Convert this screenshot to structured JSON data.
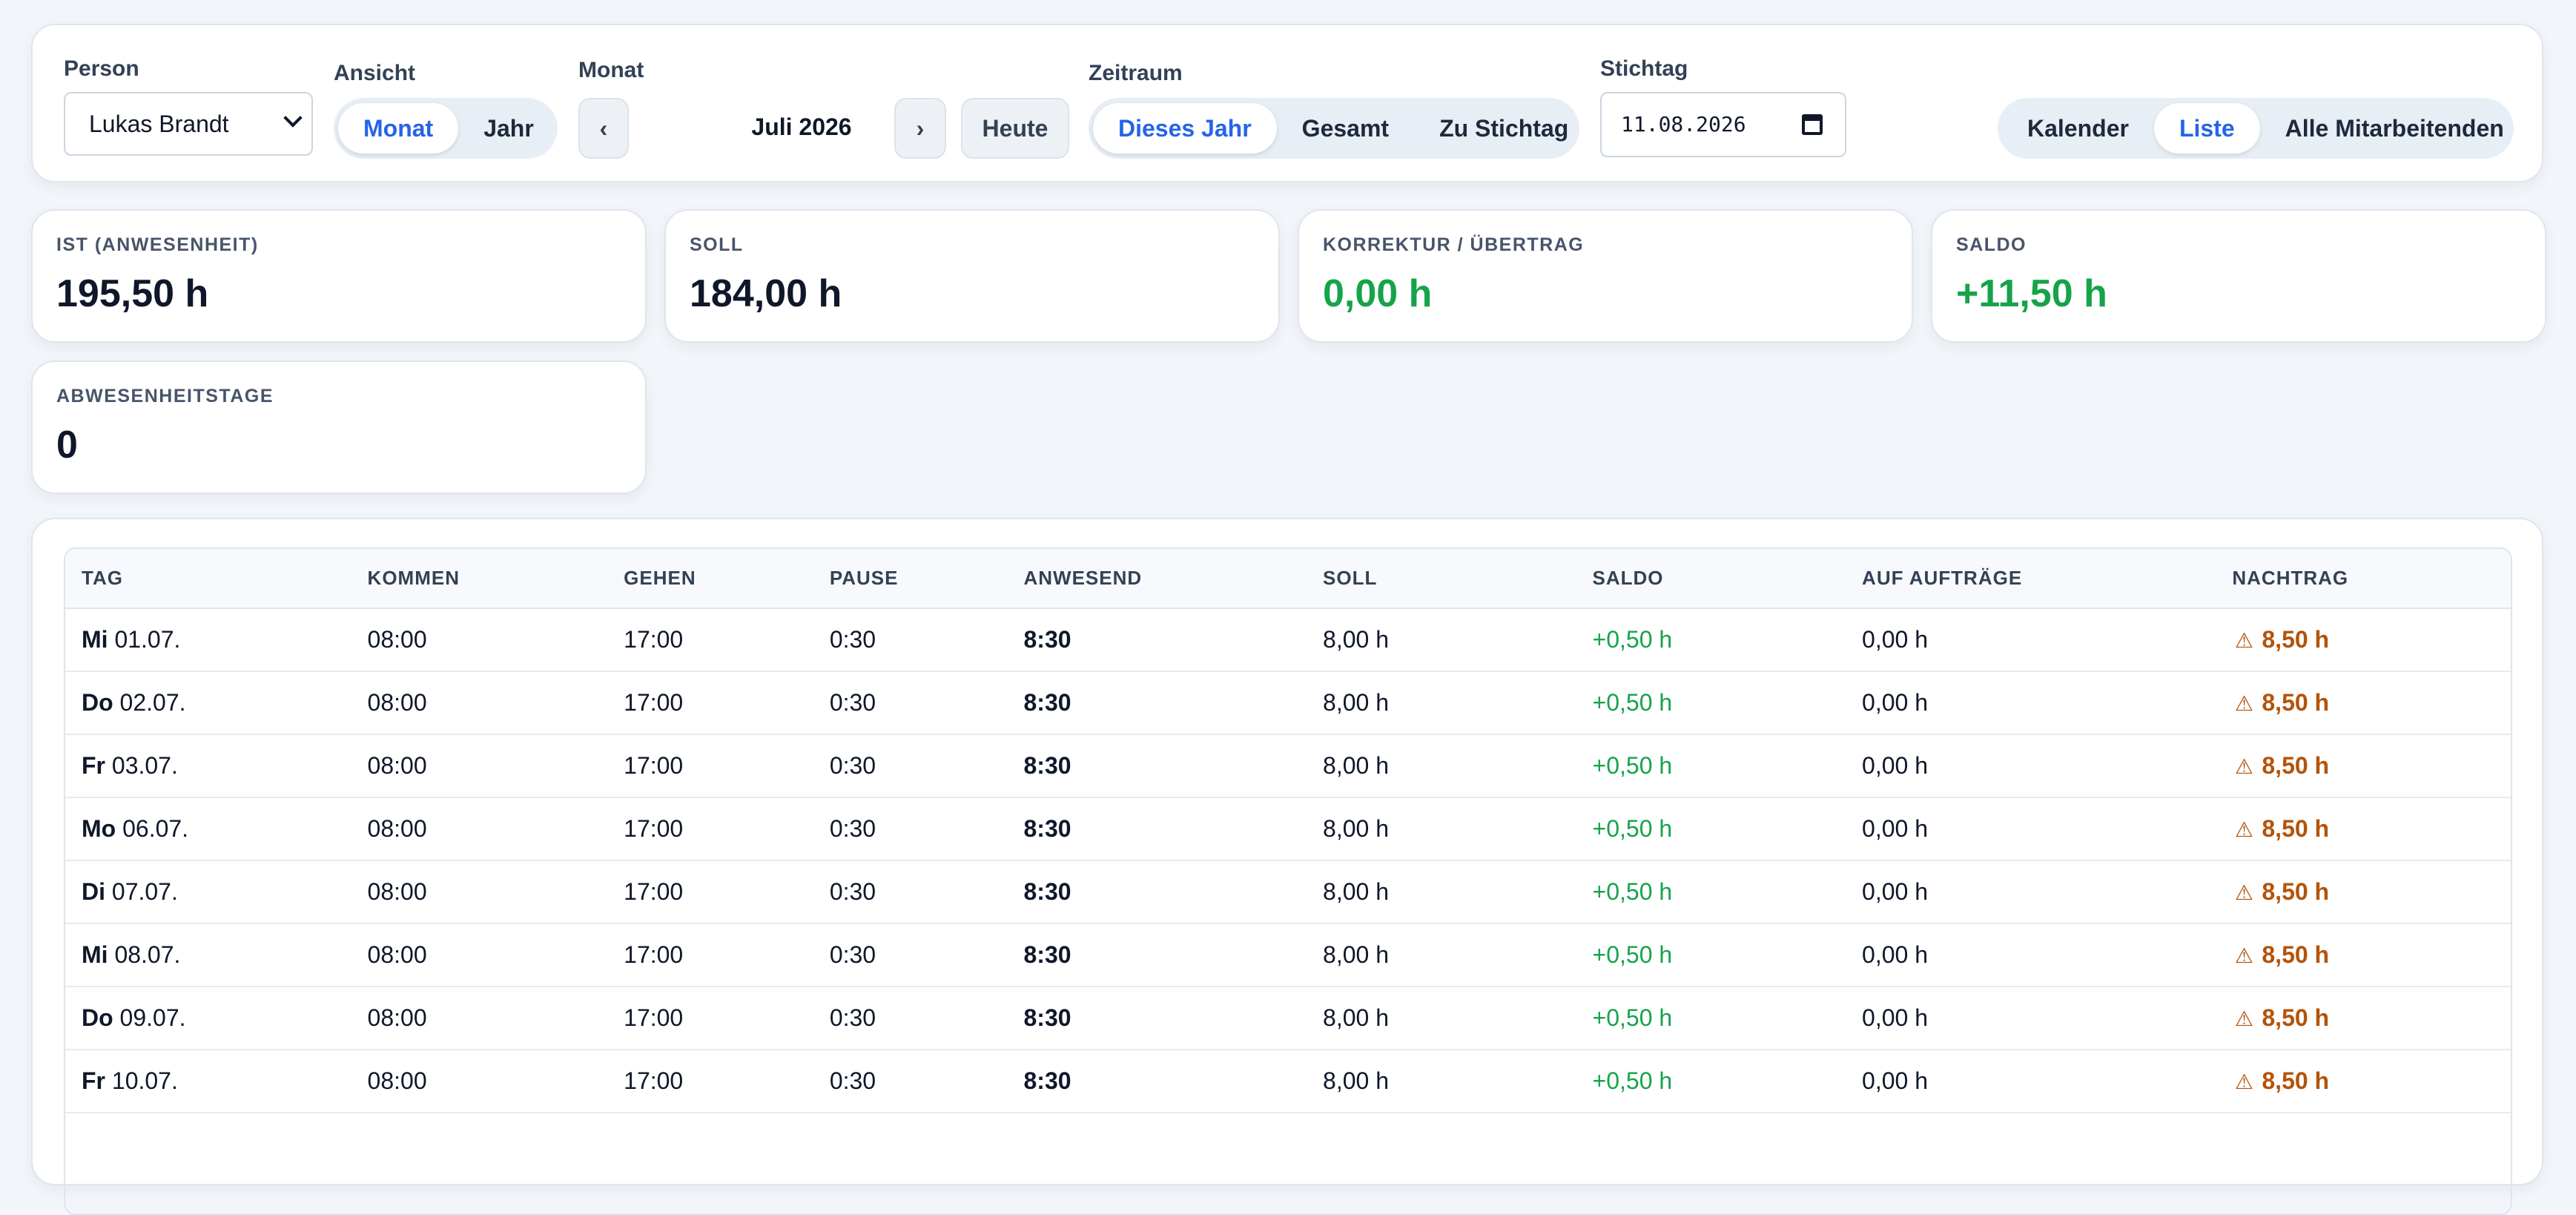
{
  "filters": {
    "person_label": "Person",
    "person_value": "Lukas Brandt",
    "view_label": "Ansicht",
    "view_options": [
      "Monat",
      "Jahr"
    ],
    "view_selected": "Monat",
    "month_label": "Monat",
    "prev_symbol": "‹",
    "month_value": "Juli 2026",
    "next_symbol": "›",
    "today_label": "Heute",
    "range_label": "Zeitraum",
    "range_options": [
      "Dieses Jahr",
      "Gesamt",
      "Zu Stichtag"
    ],
    "range_selected": "Dieses Jahr",
    "cutoff_label": "Stichtag",
    "cutoff_value": "11.08.2026",
    "mode_options": [
      "Kalender",
      "Liste",
      "Alle Mitarbeitenden"
    ],
    "mode_selected": "Liste"
  },
  "stats": [
    {
      "label": "IST (ANWESENHEIT)",
      "value": "195,50 h",
      "color": "#0f172a"
    },
    {
      "label": "SOLL",
      "value": "184,00 h",
      "color": "#0f172a"
    },
    {
      "label": "KORREKTUR / ÜBERTRAG",
      "value": "0,00 h",
      "color": "#16a34a"
    },
    {
      "label": "SALDO",
      "value": "+11,50 h",
      "color": "#16a34a"
    },
    {
      "label": "ABWESENHEITSTAGE",
      "value": "0",
      "color": "#0f172a"
    }
  ],
  "table": {
    "columns": [
      "TAG",
      "KOMMEN",
      "GEHEN",
      "PAUSE",
      "ANWESEND",
      "SOLL",
      "SALDO",
      "AUF AUFTRÄGE",
      "NACHTRAG"
    ],
    "rows": [
      {
        "weekday": "Mi",
        "date": "01.07.",
        "in": "08:00",
        "out": "17:00",
        "pause": "0:30",
        "present": "8:30",
        "target": "8,00 h",
        "balance": "+0,50 h",
        "orders": "0,00 h",
        "followup": "8,50 h"
      },
      {
        "weekday": "Do",
        "date": "02.07.",
        "in": "08:00",
        "out": "17:00",
        "pause": "0:30",
        "present": "8:30",
        "target": "8,00 h",
        "balance": "+0,50 h",
        "orders": "0,00 h",
        "followup": "8,50 h"
      },
      {
        "weekday": "Fr",
        "date": "03.07.",
        "in": "08:00",
        "out": "17:00",
        "pause": "0:30",
        "present": "8:30",
        "target": "8,00 h",
        "balance": "+0,50 h",
        "orders": "0,00 h",
        "followup": "8,50 h"
      },
      {
        "weekday": "Mo",
        "date": "06.07.",
        "in": "08:00",
        "out": "17:00",
        "pause": "0:30",
        "present": "8:30",
        "target": "8,00 h",
        "balance": "+0,50 h",
        "orders": "0,00 h",
        "followup": "8,50 h"
      },
      {
        "weekday": "Di",
        "date": "07.07.",
        "in": "08:00",
        "out": "17:00",
        "pause": "0:30",
        "present": "8:30",
        "target": "8,00 h",
        "balance": "+0,50 h",
        "orders": "0,00 h",
        "followup": "8,50 h"
      },
      {
        "weekday": "Mi",
        "date": "08.07.",
        "in": "08:00",
        "out": "17:00",
        "pause": "0:30",
        "present": "8:30",
        "target": "8,00 h",
        "balance": "+0,50 h",
        "orders": "0,00 h",
        "followup": "8,50 h"
      },
      {
        "weekday": "Do",
        "date": "09.07.",
        "in": "08:00",
        "out": "17:00",
        "pause": "0:30",
        "present": "8:30",
        "target": "8,00 h",
        "balance": "+0,50 h",
        "orders": "0,00 h",
        "followup": "8,50 h"
      },
      {
        "weekday": "Fr",
        "date": "10.07.",
        "in": "08:00",
        "out": "17:00",
        "pause": "0:30",
        "present": "8:30",
        "target": "8,00 h",
        "balance": "+0,50 h",
        "orders": "0,00 h",
        "followup": "8,50 h"
      }
    ],
    "warning_icon": "warning-icon"
  },
  "colors": {
    "accent": "#2563eb",
    "positive": "#16a34a",
    "warning": "#b45309"
  }
}
